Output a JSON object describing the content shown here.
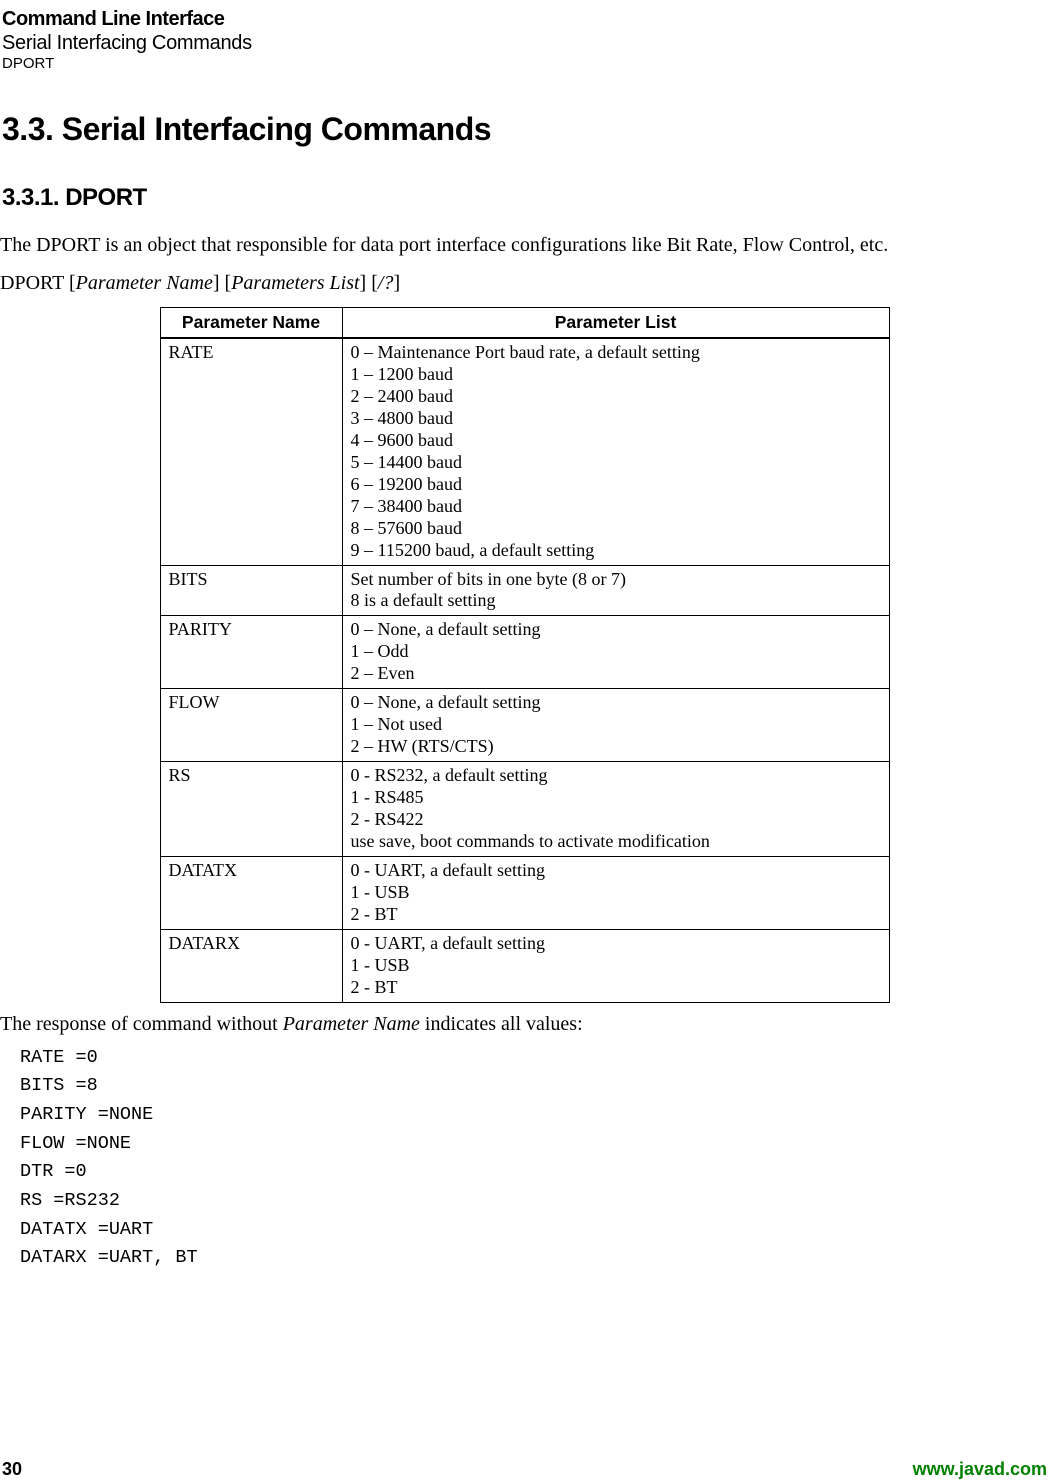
{
  "header": {
    "chapter": "Command Line Interface",
    "section": "Serial Interfacing Commands",
    "subsection": "DPORT"
  },
  "h2": "3.3. Serial Interfacing Commands",
  "h3": "3.3.1. DPORT",
  "intro": "The DPORT is an object that responsible for data port interface configurations like Bit Rate, Flow Control, etc.",
  "syntax_prefix": "DPORT [",
  "syntax_p1": "Parameter Name",
  "syntax_mid1": "] [",
  "syntax_p2": "Parameters List",
  "syntax_mid2": "] [",
  "syntax_p3": "/?",
  "syntax_suffix": "]",
  "table_headers": {
    "c1": "Parameter Name",
    "c2": "Parameter List"
  },
  "rows": [
    {
      "name": "RATE",
      "list": "0 – Maintenance Port baud rate, a default setting\n1 – 1200 baud\n2 – 2400 baud\n3 – 4800 baud\n4 – 9600 baud\n5 – 14400 baud\n6 – 19200 baud\n7 – 38400 baud\n8 – 57600 baud\n9 – 115200 baud, a default setting"
    },
    {
      "name": "BITS",
      "list": "Set number of bits in one byte (8 or 7)\n8 is a default setting"
    },
    {
      "name": "PARITY",
      "list": " 0 – None, a default setting\n1 – Odd\n2 – Even"
    },
    {
      "name": "FLOW",
      "list": "0 – None, a default setting\n1 – Not used\n2 – HW (RTS/CTS)"
    },
    {
      "name": "RS",
      "list": "0 - RS232, a default setting\n1 - RS485\n2 - RS422\nuse save, boot commands to activate modification"
    },
    {
      "name": "DATATX",
      "list": "0 - UART, a default setting\n1 - USB\n2 - BT"
    },
    {
      "name": "DATARX",
      "list": "0 - UART, a default setting\n1 - USB\n2 - BT"
    }
  ],
  "response_pre": "The response of command without ",
  "response_ital": "Parameter Name",
  "response_post": " indicates all values:",
  "response_block": "RATE =0\nBITS =8\nPARITY =NONE\nFLOW =NONE\nDTR =0\nRS =RS232\nDATATX =UART\nDATARX =UART, BT",
  "footer": {
    "page": "30",
    "url": "www.javad.com"
  }
}
